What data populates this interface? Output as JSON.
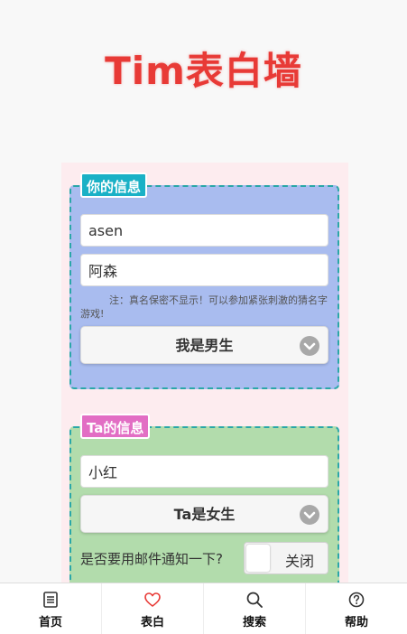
{
  "header": {
    "title": "Tim表白墙"
  },
  "your_info": {
    "tag": "你的信息",
    "username_value": "asen",
    "realname_value": "阿森",
    "note": "注：真名保密不显示！可以参加紧张刺激的猜名字游戏!",
    "gender_selected": "我是男生"
  },
  "ta_info": {
    "tag": "Ta的信息",
    "name_value": "小红",
    "gender_selected": "Ta是女生",
    "notify_label": "是否要用邮件通知一下?",
    "notify_toggle": "关闭"
  },
  "tabbar": {
    "items": [
      {
        "label": "首页",
        "icon": "document-icon",
        "color": "#333333"
      },
      {
        "label": "表白",
        "icon": "heart-icon",
        "color": "#e83a36"
      },
      {
        "label": "搜索",
        "icon": "search-icon",
        "color": "#333333"
      },
      {
        "label": "帮助",
        "icon": "help-icon",
        "color": "#333333"
      }
    ]
  },
  "colors": {
    "title": "#e83a36",
    "your_section_bg": "#a9bcef",
    "ta_section_bg": "#b2dcac",
    "your_tag_bg": "#1ab1c6",
    "ta_tag_bg": "#e26ec4"
  }
}
